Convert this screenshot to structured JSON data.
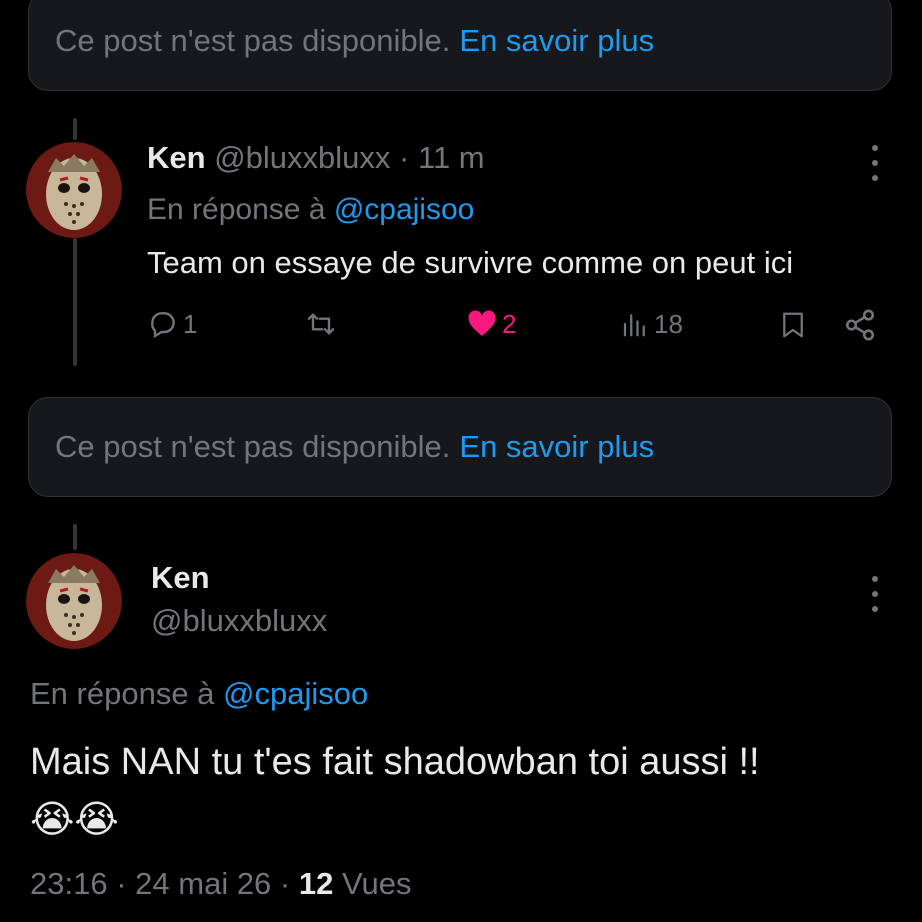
{
  "unavailable_notice": {
    "text": "Ce post n'est pas disponible.",
    "link": "En savoir plus"
  },
  "reply_tweet": {
    "display_name": "Ken",
    "handle": "@bluxxbluxx",
    "separator": "·",
    "time": "11 m",
    "reply_prefix": "En réponse à",
    "reply_to": "@cpajisoo",
    "body": "Team on essaye de survivre comme on peut ici",
    "actions": {
      "replies": "1",
      "likes": "2",
      "views": "18"
    }
  },
  "unavailable_notice_2": {
    "text": "Ce post n'est pas disponible.",
    "link": "En savoir plus"
  },
  "main_tweet": {
    "display_name": "Ken",
    "handle": "@bluxxbluxx",
    "reply_prefix": "En réponse à",
    "reply_to": "@cpajisoo",
    "body": "Mais NAN tu t'es fait shadowban toi aussi !!",
    "emojis": "😭😭",
    "time": "23:16",
    "separator": "·",
    "date": "24 mai 26",
    "separator2": "·",
    "views_count": "12",
    "views_label": "Vues"
  },
  "colors": {
    "accent": "#1d9bf0",
    "like": "#f91880",
    "muted": "#71767b"
  }
}
